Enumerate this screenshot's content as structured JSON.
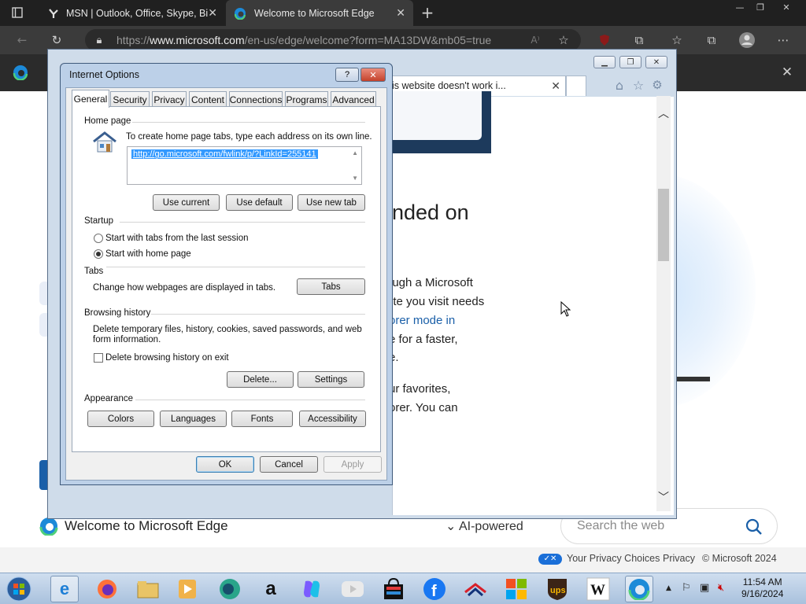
{
  "browser": {
    "tabs": [
      {
        "title": "MSN | Outlook, Office, Skype, Bi",
        "icon": "msn-icon"
      },
      {
        "title": "Welcome to Microsoft Edge",
        "icon": "edge-icon"
      }
    ],
    "url_prefix": "https://",
    "url_domain": "www.microsoft.com",
    "url_rest": "/en-us/edge/welcome?form=MA13DW&mb05=true"
  },
  "page": {
    "welcome_label": "Welcome to Microsoft Edge",
    "ai_label": "AI-powered",
    "search_placeholder": "Search the web",
    "privacy_choices": "Your Privacy Choices",
    "privacy": "Privacy",
    "copyright": "© Microsoft 2024"
  },
  "ie": {
    "tab_title": "is website doesn't work i...",
    "text_lines": [
      "nded on",
      "ough a Microsoft",
      "ite you visit needs",
      "orer mode in",
      "e for a faster,",
      "e.",
      "ur favorites,",
      "orer. You can"
    ],
    "link_color": "#1a5fa8"
  },
  "dialog": {
    "title": "Internet Options",
    "help_label": "?",
    "close_label": "✕",
    "tabs": [
      "General",
      "Security",
      "Privacy",
      "Content",
      "Connections",
      "Programs",
      "Advanced"
    ],
    "home_page": {
      "heading": "Home page",
      "instruction": "To create home page tabs, type each address on its own line.",
      "url": "http://go.microsoft.com/fwlink/p/?LinkId=255141",
      "use_current": "Use current",
      "use_default": "Use default",
      "use_new_tab": "Use new tab"
    },
    "startup": {
      "heading": "Startup",
      "option_last_session": "Start with tabs from the last session",
      "option_home_page": "Start with home page",
      "selected": "home_page"
    },
    "tabs_section": {
      "heading": "Tabs",
      "description": "Change how webpages are displayed in tabs.",
      "button": "Tabs"
    },
    "browsing_history": {
      "heading": "Browsing history",
      "description_line1": "Delete temporary files, history, cookies, saved passwords, and web",
      "description_line2": "form information.",
      "checkbox_label": "Delete browsing history on exit",
      "checked": false,
      "delete_button": "Delete...",
      "settings_button": "Settings"
    },
    "appearance": {
      "heading": "Appearance",
      "colors": "Colors",
      "languages": "Languages",
      "fonts": "Fonts",
      "accessibility": "Accessibility"
    },
    "ok": "OK",
    "cancel": "Cancel",
    "apply": "Apply"
  },
  "taskbar": {
    "apps": [
      "start-orb",
      "internet-explorer-icon",
      "firefox-icon",
      "file-explorer-icon",
      "media-player-icon",
      "app-icon",
      "amazon-icon",
      "copilot-icon",
      "youtube-icon",
      "store-icon",
      "facebook-icon",
      "bank-icon",
      "microsoft-icon",
      "ups-icon",
      "wikipedia-icon",
      "edge-icon"
    ],
    "time": "11:54 AM",
    "date": "9/16/2024"
  }
}
